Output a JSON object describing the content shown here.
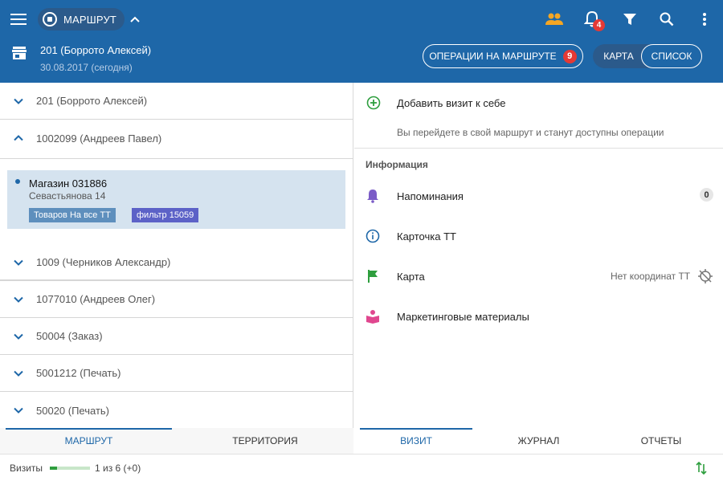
{
  "header": {
    "route_label": "МАРШРУТ",
    "notifications_count": "4",
    "title": "201 (Боррото Алексей)",
    "subtitle": "30.08.2017 (сегодня)",
    "ops_button": "ОПЕРАЦИИ НА МАРШРУТЕ",
    "ops_count": "9",
    "map_label": "КАРТА",
    "list_label": "СПИСОК"
  },
  "left": {
    "rows": [
      "201 (Боррото Алексей)",
      "1002099 (Андреев Павел)",
      "1009 (Черников Александр)",
      "1077010 (Андреев Олег)",
      "50004 (Заказ)",
      "5001212 (Печать)",
      "50020 (Печать)"
    ],
    "shop": {
      "name": "Магазин 031886",
      "address": "Севастьянова 14",
      "tags": [
        "Товаров На все ТТ",
        "фильтр 15059"
      ]
    },
    "tabs": [
      "МАРШРУТ",
      "ТЕРРИТОРИЯ"
    ]
  },
  "right": {
    "add_visit": "Добавить визит к себе",
    "add_visit_hint": "Вы перейдете в свой маршрут и станут доступны операции",
    "section_info": "Информация",
    "reminders": "Напоминания",
    "reminders_count": "0",
    "card": "Карточка ТТ",
    "map": "Карта",
    "no_coords": "Нет координат ТТ",
    "marketing": "Маркетинговые материалы",
    "tabs": [
      "ВИЗИТ",
      "ЖУРНАЛ",
      "ОТЧЕТЫ"
    ]
  },
  "footer": {
    "visits_label": "Визиты",
    "progress": 0.17,
    "visits_count": "1 из 6 (+0)"
  },
  "colors": {
    "primary": "#1e67a8",
    "accent_orange": "#f5a623",
    "badge_red": "#e53935",
    "green": "#2e9e3e",
    "purple": "#7b5cc7",
    "pink": "#e0478f"
  }
}
